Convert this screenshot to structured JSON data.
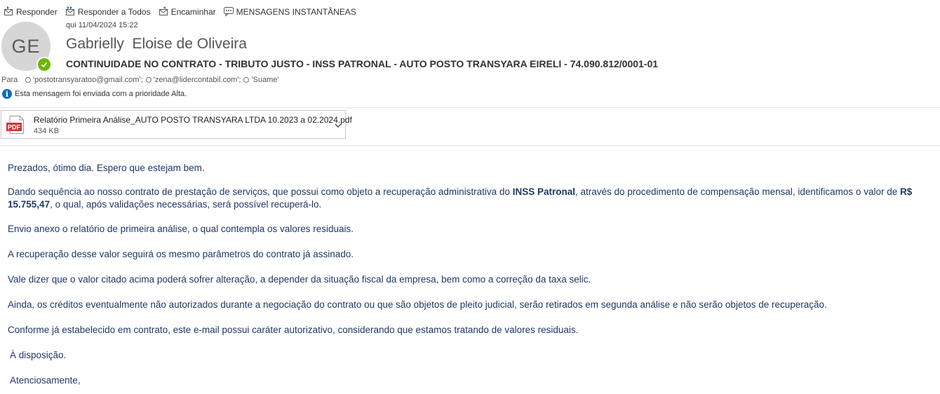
{
  "toolbar": {
    "reply": "Responder",
    "reply_all": "Responder a Todos",
    "forward": "Encaminhar",
    "im": "MENSAGENS INSTANTÂNEAS"
  },
  "message": {
    "avatar_initials": "GE",
    "date": "qui 11/04/2024 15:22",
    "sender": "Gabrielly  Eloise de Oliveira",
    "subject": "CONTINUIDADE NO CONTRATO - TRIBUTO JUSTO - INSS PATRONAL - AUTO POSTO TRANSYARA EIRELI - 74.090.812/0001-01",
    "to_label": "Para",
    "recipients": [
      "'postotransyaratoo@gmail.com';",
      "'zena@lidercontabil.com';",
      "'Suame'"
    ],
    "priority_notice": "Esta mensagem foi enviada com a prioridade Alta."
  },
  "attachment": {
    "filename": "Relatório Primeira Análise_AUTO POSTO TRANSYARA LTDA 10.2023 a 02.2024.pdf",
    "size": "434 KB",
    "type_label": "PDF"
  },
  "body": {
    "p1": "Prezados, ótimo dia. Espero que estejam bem.",
    "p2_a": "Dando sequência ao nosso contrato de prestação de serviços, que possui como objeto a recuperação administrativa do ",
    "p2_b": "INSS Patronal",
    "p2_c": ", através do procedimento de compensação mensal, identificamos o valor de ",
    "p2_d": "R$ 15.755,47",
    "p2_e": ", o qual, após validações necessárias, será possível recuperá-lo.",
    "p3": "Envio anexo o relatório de primeira análise, o qual contempla os valores residuais.",
    "p4": "A recuperação desse valor seguirá os mesmo parâmetros do contrato já assinado.",
    "p5": "Vale dizer que o valor citado acima poderá sofrer alteração, a depender da situação fiscal da empresa, bem como a correção da taxa selic.",
    "p6": "Ainda, os créditos eventualmente não autorizados durante a negociação do contrato ou que são objetos de pleito judicial, serão retirados em segunda análise e não serão objetos de recuperação.",
    "p7": "Conforme já estabelecido em contrato, este e-mail possui caráter autorizativo, considerando que estamos tratando de valores residuais.",
    "p8": "À disposição.",
    "p9": "Atenciosamente,"
  },
  "colors": {
    "body_text": "#1f3864",
    "presence": "#6bb700",
    "info": "#0f6cbd",
    "pdf_red": "#d13438"
  }
}
